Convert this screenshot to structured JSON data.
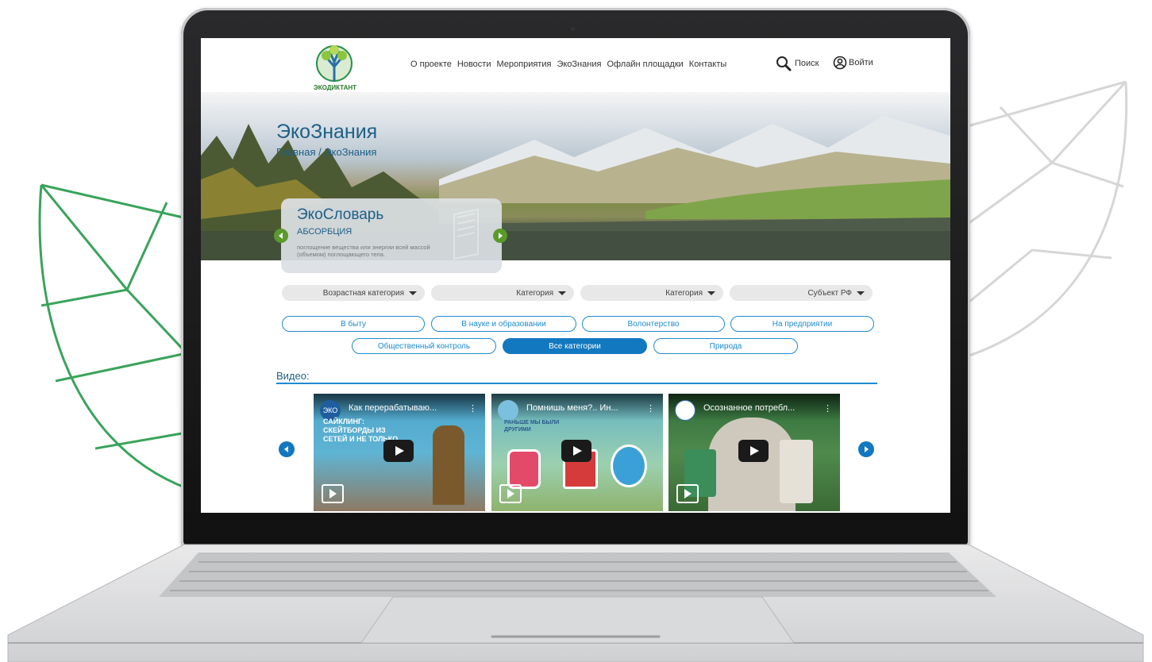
{
  "nav": {
    "logo_text": "ЭКОДИКТАНТ",
    "links": [
      "О проекте",
      "Новости",
      "Мероприятия",
      "ЭкоЗнания",
      "Офлайн площадки",
      "Контакты"
    ],
    "search_label": "Поиск",
    "login_label": "Войти"
  },
  "hero": {
    "title": "ЭкоЗнания",
    "breadcrumb": "Главная / ЭкоЗнания"
  },
  "dictionary": {
    "title": "ЭкоСловарь",
    "word": "АБСОРБЦИЯ",
    "definition": "поглощение вещества или энергии всей массой (объемом) поглощающего тела."
  },
  "filters": {
    "selects": [
      "Возрастная категория",
      "Категория",
      "Категория",
      "Субъект РФ"
    ]
  },
  "chips": {
    "row1": [
      "В быту",
      "В науке и образовании",
      "Волонтерство",
      "На предприятии"
    ],
    "row2": [
      "Общественный контроль",
      "Все категории",
      "Природа"
    ],
    "active": "Все категории"
  },
  "videos": {
    "label": "Видео:",
    "items": [
      {
        "title": "Как перерабатываю...",
        "overlay": "САЙКЛИНГ: СКЕЙТБОРДЫ ИЗ СЕТЕЙ И НЕ ТОЛЬКО",
        "channel": "ЭКО"
      },
      {
        "title": "Помнишь меня?.. Ин...",
        "overlay": "РАНЬШЕ МЫ БЫЛИ ДРУГИМИ",
        "channel": ""
      },
      {
        "title": "Осознанное потребл...",
        "overlay": "",
        "channel": ""
      }
    ]
  },
  "colors": {
    "accent_blue": "#1278bf",
    "title_blue": "#1d5f86",
    "green_leaf": "#3aa35b",
    "grey_leaf": "#d6d6d6",
    "nav_arrow_green": "#5a9a2a"
  }
}
